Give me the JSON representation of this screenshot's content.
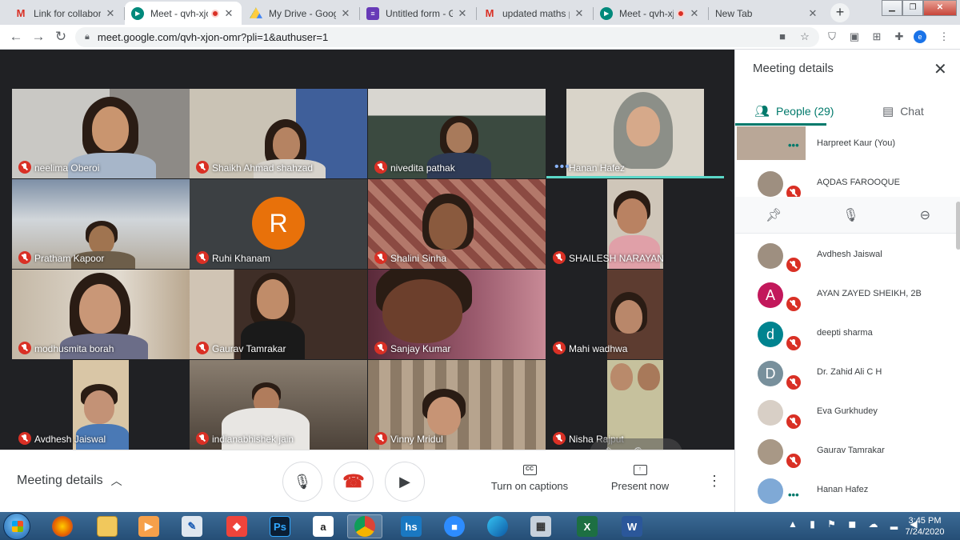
{
  "browser": {
    "tabs": [
      {
        "title": "Link for collaborati",
        "favicon": "gmail-icon",
        "active": false
      },
      {
        "title": "Meet - qvh-xjo",
        "favicon": "meet-icon",
        "active": true,
        "recording": true
      },
      {
        "title": "My Drive - Google",
        "favicon": "drive-icon",
        "active": false
      },
      {
        "title": "Untitled form - Goo",
        "favicon": "forms-icon",
        "active": false
      },
      {
        "title": "updated maths pt",
        "favicon": "gmail-icon",
        "active": false
      },
      {
        "title": "Meet - qvh-xjo",
        "favicon": "meet-icon",
        "active": false,
        "recording": true
      },
      {
        "title": "New Tab",
        "favicon": "",
        "active": false
      }
    ],
    "url": "meet.google.com/qvh-xjon-omr?pli=1&authuser=1"
  },
  "tiles": [
    {
      "name": "neelima Oberoi",
      "bg": "#9a9590",
      "muted": true
    },
    {
      "name": "Shaikh Ahmad shahzad",
      "bg": "#5d5549",
      "muted": true
    },
    {
      "name": "nivedita pathak",
      "bg": "#3f4a42",
      "muted": true
    },
    {
      "name": "Hanan Hafez",
      "bg": "#cfc9bd",
      "muted": false,
      "speaking": true
    },
    {
      "name": "Pratham Kapoor",
      "bg": "#7a8a9a",
      "muted": true
    },
    {
      "name": "Ruhi Khanam",
      "bg": "#3c4043",
      "muted": true,
      "initial": "R"
    },
    {
      "name": "Shalini Sinha",
      "bg": "#8b5249",
      "muted": true
    },
    {
      "name": "SHAILESH NARAYAN",
      "bg": "#2b2b2b",
      "muted": true
    },
    {
      "name": "modhusmita borah",
      "bg": "#b5a998",
      "muted": true
    },
    {
      "name": "Gaurav Tamrakar",
      "bg": "#4c3b33",
      "muted": true
    },
    {
      "name": "Sanjay Kumar",
      "bg": "#6e3d4c",
      "muted": true
    },
    {
      "name": "Mahi wadhwa",
      "bg": "#2a2a2a",
      "muted": true
    },
    {
      "name": "Avdhesh Jaiswal",
      "bg": "#2a2a2a",
      "muted": true
    },
    {
      "name": "indianabhishek jain",
      "bg": "#655a4f",
      "muted": true
    },
    {
      "name": "Vinny Mridul",
      "bg": "#7a6a58",
      "muted": true
    },
    {
      "name": "Nisha Rajput",
      "bg": "#2a2a2a",
      "muted": true
    }
  ],
  "bottom_bar": {
    "meeting_details": "Meeting details",
    "captions_label": "Turn on captions",
    "captions_icon_text": "CC",
    "present_label": "Present now"
  },
  "panel": {
    "title": "Meeting details",
    "people_tab": "People (29)",
    "chat_tab": "Chat",
    "people": [
      {
        "name": "Harpreet Kaur (You)",
        "avatar": "photo",
        "self": true
      },
      {
        "name": "AQDAS FAROOQUE",
        "avatar": "photo",
        "muted": true
      },
      {
        "name": "Avdhesh Jaiswal",
        "avatar": "photo",
        "muted": true
      },
      {
        "name": "AYAN ZAYED SHEIKH, 2B",
        "avatar": "A",
        "color": "#c2185b",
        "muted": true
      },
      {
        "name": "deepti sharma",
        "avatar": "d",
        "color": "#00838f",
        "muted": true
      },
      {
        "name": "Dr. Zahid Ali C H",
        "avatar": "D",
        "color": "#78909c",
        "muted": true
      },
      {
        "name": "Eva Gurkhudey",
        "avatar": "photo",
        "muted": true
      },
      {
        "name": "Gaurav Tamrakar",
        "avatar": "photo",
        "muted": true
      },
      {
        "name": "Hanan Hafez",
        "avatar": "photo",
        "speaking": true
      }
    ]
  },
  "taskbar": {
    "icons": [
      "firefox-icon",
      "explorer-icon",
      "media-player-icon",
      "paint-icon",
      "anydesk-icon",
      "photoshop-icon",
      "audible-icon",
      "chrome-icon",
      "hubstaff-icon",
      "zoom-icon",
      "edge-icon",
      "calculator-icon",
      "excel-icon",
      "word-icon"
    ],
    "photoshop_text": "Ps",
    "hs_text": "hs",
    "time": "3:45 PM",
    "date": "7/24/2020"
  }
}
